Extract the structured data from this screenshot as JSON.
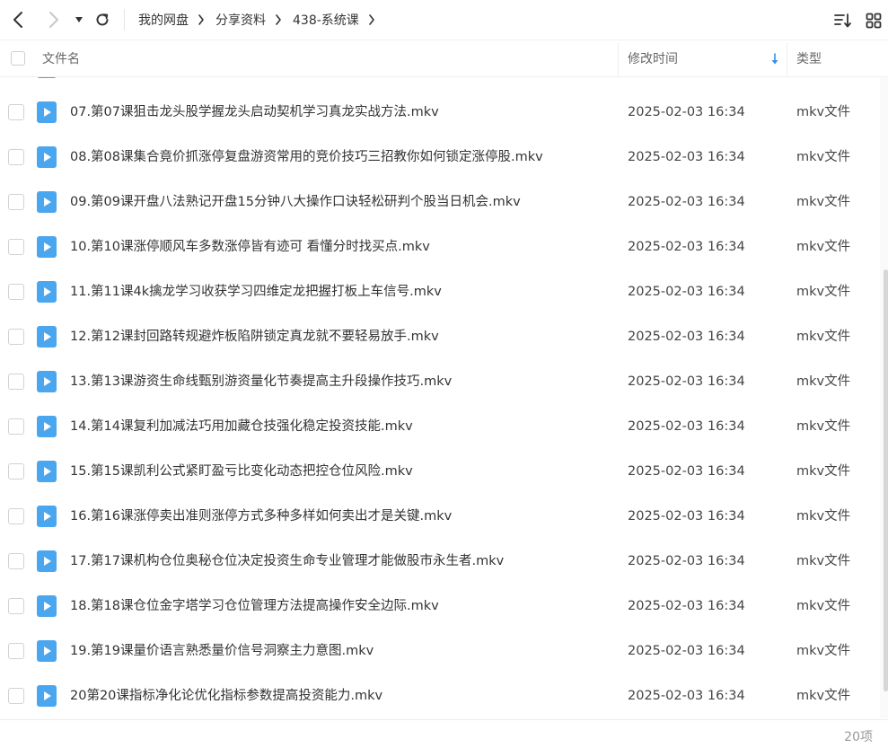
{
  "toolbar": {
    "breadcrumb": [
      "我的网盘",
      "分享资料",
      "438-系统课"
    ],
    "icons": {
      "back": "chevron-left-icon",
      "forward": "chevron-right-icon",
      "history": "dropdown-triangle-icon",
      "refresh": "refresh-icon",
      "sort": "sort-list-icon",
      "view": "grid-view-icon"
    }
  },
  "header": {
    "name": "文件名",
    "time": "修改时间",
    "type": "类型"
  },
  "files": [
    {
      "name": "07.第07课狙击龙头股学握龙头启动契机学习真龙实战方法.mkv",
      "time": "2025-02-03 16:34",
      "type": "mkv文件"
    },
    {
      "name": "08.第08课集合竟价抓涨停复盘游资常用的竞价技巧三招教你如何锁定涨停股.mkv",
      "time": "2025-02-03 16:34",
      "type": "mkv文件"
    },
    {
      "name": "09.第09课开盘八法熟记开盘15分钟八大操作口诀轻松研判个股当日机会.mkv",
      "time": "2025-02-03 16:34",
      "type": "mkv文件"
    },
    {
      "name": "10.第10课涨停顺风车多数涨停皆有迹可 看懂分时找买点.mkv",
      "time": "2025-02-03 16:34",
      "type": "mkv文件"
    },
    {
      "name": "11.第11课4k擒龙学习收获学习四维定龙把握打板上车信号.mkv",
      "time": "2025-02-03 16:34",
      "type": "mkv文件"
    },
    {
      "name": "12.第12课封回路转规避炸板陷阱锁定真龙就不要轻易放手.mkv",
      "time": "2025-02-03 16:34",
      "type": "mkv文件"
    },
    {
      "name": "13.第13课游资生命线甄别游资量化节奏提高主升段操作技巧.mkv",
      "time": "2025-02-03 16:34",
      "type": "mkv文件"
    },
    {
      "name": "14.第14课复利加减法巧用加藏仓技强化稳定投资技能.mkv",
      "time": "2025-02-03 16:34",
      "type": "mkv文件"
    },
    {
      "name": "15.第15课凯利公式紧盯盈亏比变化动态把控仓位风险.mkv",
      "time": "2025-02-03 16:34",
      "type": "mkv文件"
    },
    {
      "name": "16.第16课涨停卖出准则涨停方式多种多样如何卖出才是关键.mkv",
      "time": "2025-02-03 16:34",
      "type": "mkv文件"
    },
    {
      "name": "17.第17课机构仓位奥秘仓位决定投资生命专业管理才能做股市永生者.mkv",
      "time": "2025-02-03 16:34",
      "type": "mkv文件"
    },
    {
      "name": "18.第18课仓位金字塔学习仓位管理方法提高操作安全边际.mkv",
      "time": "2025-02-03 16:34",
      "type": "mkv文件"
    },
    {
      "name": "19.第19课量价语言熟悉量价信号洞察主力意图.mkv",
      "time": "2025-02-03 16:34",
      "type": "mkv文件"
    },
    {
      "name": "20第20课指标净化论优化指标参数提高投资能力.mkv",
      "time": "2025-02-03 16:34",
      "type": "mkv文件"
    }
  ],
  "footer": {
    "count": "20项"
  },
  "colors": {
    "file_icon": "#4aa6ee",
    "sort_arrow": "#3a8ee6"
  }
}
